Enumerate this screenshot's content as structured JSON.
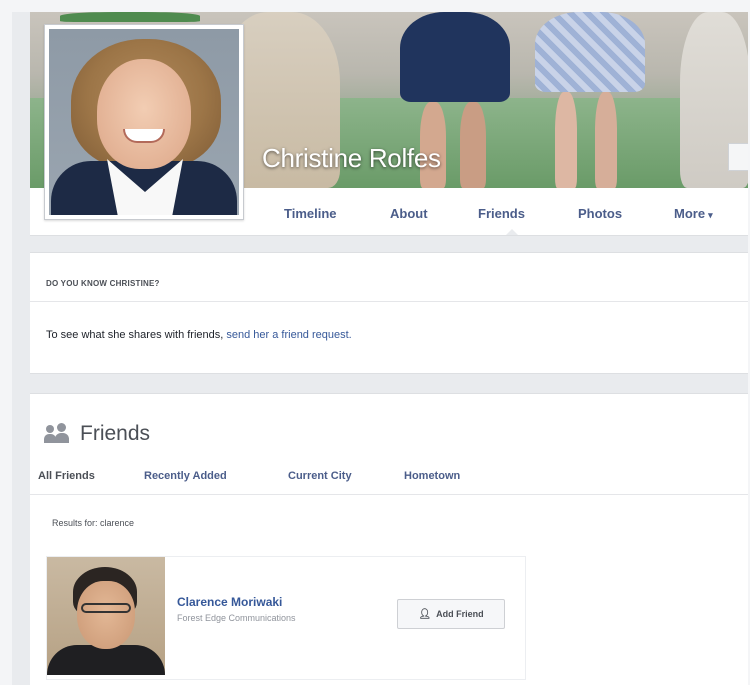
{
  "profile": {
    "name": "Christine Rolfes"
  },
  "tabs": [
    {
      "label": "Timeline"
    },
    {
      "label": "About"
    },
    {
      "label": "Friends"
    },
    {
      "label": "Photos"
    },
    {
      "label": "More"
    }
  ],
  "more_caret": "▾",
  "know": {
    "heading": "DO YOU KNOW CHRISTINE?",
    "text_prefix": "To see what she shares with friends, ",
    "link": "send her a friend request."
  },
  "friends": {
    "title": "Friends",
    "subtabs": [
      {
        "label": "All Friends"
      },
      {
        "label": "Recently Added"
      },
      {
        "label": "Current City"
      },
      {
        "label": "Hometown"
      }
    ],
    "results_label": "Results for: clarence",
    "items": [
      {
        "name": "Clarence Moriwaki",
        "subtitle": "Forest Edge Communications",
        "button": "Add Friend"
      }
    ]
  },
  "icons": {
    "friends": "people-icon",
    "add_friend": "add-friend-icon"
  },
  "colors": {
    "link": "#365899",
    "tab_text": "#4b5d8a",
    "background": "#e9ebee"
  }
}
